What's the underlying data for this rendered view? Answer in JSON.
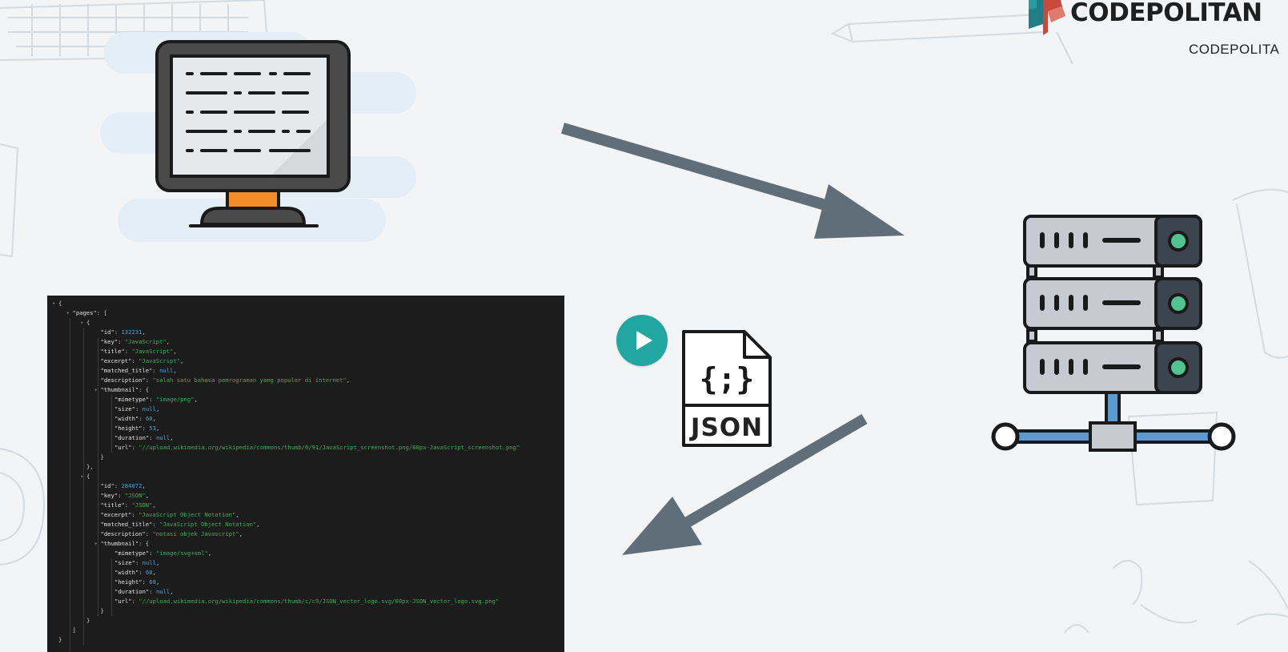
{
  "brand": {
    "name": "CODEPOLITAN",
    "sub": "CODEPOLITA"
  },
  "colors": {
    "background": "#f3f4f5",
    "arrow": "#5f6e78",
    "teal": "#22a6a1",
    "orange": "#f28c28",
    "server_body": "#c7cbd1",
    "server_blue": "#5b9bd5",
    "code_bg": "#1c1c1c",
    "code_string": "#3fae5a",
    "code_number": "#4aa3df"
  },
  "icons": {
    "client": "monitor-icon",
    "server": "server-rack-icon",
    "file": "json-file-icon",
    "play": "play-icon"
  },
  "json_file": {
    "braces": "{;}",
    "label": "JSON"
  },
  "code_lines": [
    {
      "toggle": "▾",
      "indent": 0,
      "text": [
        {
          "t": "punc",
          "v": "{"
        }
      ]
    },
    {
      "toggle": "▾",
      "indent": 1,
      "text": [
        {
          "t": "key",
          "v": "\"pages\""
        },
        {
          "t": "punc",
          "v": ": ["
        }
      ]
    },
    {
      "toggle": "▾",
      "indent": 2,
      "text": [
        {
          "t": "punc",
          "v": "{"
        }
      ]
    },
    {
      "toggle": "",
      "indent": 3,
      "text": [
        {
          "t": "key",
          "v": "\"id\""
        },
        {
          "t": "punc",
          "v": ": "
        },
        {
          "t": "num",
          "v": "132231"
        },
        {
          "t": "punc",
          "v": ","
        }
      ]
    },
    {
      "toggle": "",
      "indent": 3,
      "text": [
        {
          "t": "key",
          "v": "\"key\""
        },
        {
          "t": "punc",
          "v": ": "
        },
        {
          "t": "str",
          "v": "\"JavaScript\""
        },
        {
          "t": "punc",
          "v": ","
        }
      ]
    },
    {
      "toggle": "",
      "indent": 3,
      "text": [
        {
          "t": "key",
          "v": "\"title\""
        },
        {
          "t": "punc",
          "v": ": "
        },
        {
          "t": "str",
          "v": "\"JavaScript\""
        },
        {
          "t": "punc",
          "v": ","
        }
      ]
    },
    {
      "toggle": "",
      "indent": 3,
      "text": [
        {
          "t": "key",
          "v": "\"excerpt\""
        },
        {
          "t": "punc",
          "v": ": "
        },
        {
          "t": "str",
          "v": "\"JavaScript\""
        },
        {
          "t": "punc",
          "v": ","
        }
      ]
    },
    {
      "toggle": "",
      "indent": 3,
      "text": [
        {
          "t": "key",
          "v": "\"matched_title\""
        },
        {
          "t": "punc",
          "v": ": "
        },
        {
          "t": "null",
          "v": "null"
        },
        {
          "t": "punc",
          "v": ","
        }
      ]
    },
    {
      "toggle": "",
      "indent": 3,
      "text": [
        {
          "t": "key",
          "v": "\"description\""
        },
        {
          "t": "punc",
          "v": ": "
        },
        {
          "t": "str",
          "v": "\"salah satu bahasa pemrograman yang populer di internet\""
        },
        {
          "t": "punc",
          "v": ","
        }
      ]
    },
    {
      "toggle": "▾",
      "indent": 3,
      "text": [
        {
          "t": "key",
          "v": "\"thumbnail\""
        },
        {
          "t": "punc",
          "v": ": {"
        }
      ]
    },
    {
      "toggle": "",
      "indent": 4,
      "text": [
        {
          "t": "key",
          "v": "\"mimetype\""
        },
        {
          "t": "punc",
          "v": ": "
        },
        {
          "t": "str",
          "v": "\"image/png\""
        },
        {
          "t": "punc",
          "v": ","
        }
      ]
    },
    {
      "toggle": "",
      "indent": 4,
      "text": [
        {
          "t": "key",
          "v": "\"size\""
        },
        {
          "t": "punc",
          "v": ": "
        },
        {
          "t": "null",
          "v": "null"
        },
        {
          "t": "punc",
          "v": ","
        }
      ]
    },
    {
      "toggle": "",
      "indent": 4,
      "text": [
        {
          "t": "key",
          "v": "\"width\""
        },
        {
          "t": "punc",
          "v": ": "
        },
        {
          "t": "num",
          "v": "60"
        },
        {
          "t": "punc",
          "v": ","
        }
      ]
    },
    {
      "toggle": "",
      "indent": 4,
      "text": [
        {
          "t": "key",
          "v": "\"height\""
        },
        {
          "t": "punc",
          "v": ": "
        },
        {
          "t": "num",
          "v": "53"
        },
        {
          "t": "punc",
          "v": ","
        }
      ]
    },
    {
      "toggle": "",
      "indent": 4,
      "text": [
        {
          "t": "key",
          "v": "\"duration\""
        },
        {
          "t": "punc",
          "v": ": "
        },
        {
          "t": "null",
          "v": "null"
        },
        {
          "t": "punc",
          "v": ","
        }
      ]
    },
    {
      "toggle": "",
      "indent": 4,
      "text": [
        {
          "t": "key",
          "v": "\"url\""
        },
        {
          "t": "punc",
          "v": ": "
        },
        {
          "t": "str",
          "v": "\"//upload.wikimedia.org/wikipedia/commons/thumb/6/91/JavaScript_screenshot.png/60px-JavaScript_screenshot.png\""
        }
      ]
    },
    {
      "toggle": "",
      "indent": 3,
      "text": [
        {
          "t": "punc",
          "v": "}"
        }
      ]
    },
    {
      "toggle": "",
      "indent": 2,
      "text": [
        {
          "t": "punc",
          "v": "},"
        }
      ]
    },
    {
      "toggle": "▾",
      "indent": 2,
      "text": [
        {
          "t": "punc",
          "v": "{"
        }
      ]
    },
    {
      "toggle": "",
      "indent": 3,
      "text": [
        {
          "t": "key",
          "v": "\"id\""
        },
        {
          "t": "punc",
          "v": ": "
        },
        {
          "t": "num",
          "v": "284072"
        },
        {
          "t": "punc",
          "v": ","
        }
      ]
    },
    {
      "toggle": "",
      "indent": 3,
      "text": [
        {
          "t": "key",
          "v": "\"key\""
        },
        {
          "t": "punc",
          "v": ": "
        },
        {
          "t": "str",
          "v": "\"JSON\""
        },
        {
          "t": "punc",
          "v": ","
        }
      ]
    },
    {
      "toggle": "",
      "indent": 3,
      "text": [
        {
          "t": "key",
          "v": "\"title\""
        },
        {
          "t": "punc",
          "v": ": "
        },
        {
          "t": "str",
          "v": "\"JSON\""
        },
        {
          "t": "punc",
          "v": ","
        }
      ]
    },
    {
      "toggle": "",
      "indent": 3,
      "text": [
        {
          "t": "key",
          "v": "\"excerpt\""
        },
        {
          "t": "punc",
          "v": ": "
        },
        {
          "t": "str",
          "v": "\"JavaScript Object Notation\""
        },
        {
          "t": "punc",
          "v": ","
        }
      ]
    },
    {
      "toggle": "",
      "indent": 3,
      "text": [
        {
          "t": "key",
          "v": "\"matched_title\""
        },
        {
          "t": "punc",
          "v": ": "
        },
        {
          "t": "str",
          "v": "\"JavaScript Object Notation\""
        },
        {
          "t": "punc",
          "v": ","
        }
      ]
    },
    {
      "toggle": "",
      "indent": 3,
      "text": [
        {
          "t": "key",
          "v": "\"description\""
        },
        {
          "t": "punc",
          "v": ": "
        },
        {
          "t": "str",
          "v": "\"notasi objek Javascript\""
        },
        {
          "t": "punc",
          "v": ","
        }
      ]
    },
    {
      "toggle": "▾",
      "indent": 3,
      "text": [
        {
          "t": "key",
          "v": "\"thumbnail\""
        },
        {
          "t": "punc",
          "v": ": {"
        }
      ]
    },
    {
      "toggle": "",
      "indent": 4,
      "text": [
        {
          "t": "key",
          "v": "\"mimetype\""
        },
        {
          "t": "punc",
          "v": ": "
        },
        {
          "t": "str",
          "v": "\"image/svg+xml\""
        },
        {
          "t": "punc",
          "v": ","
        }
      ]
    },
    {
      "toggle": "",
      "indent": 4,
      "text": [
        {
          "t": "key",
          "v": "\"size\""
        },
        {
          "t": "punc",
          "v": ": "
        },
        {
          "t": "null",
          "v": "null"
        },
        {
          "t": "punc",
          "v": ","
        }
      ]
    },
    {
      "toggle": "",
      "indent": 4,
      "text": [
        {
          "t": "key",
          "v": "\"width\""
        },
        {
          "t": "punc",
          "v": ": "
        },
        {
          "t": "num",
          "v": "60"
        },
        {
          "t": "punc",
          "v": ","
        }
      ]
    },
    {
      "toggle": "",
      "indent": 4,
      "text": [
        {
          "t": "key",
          "v": "\"height\""
        },
        {
          "t": "punc",
          "v": ": "
        },
        {
          "t": "num",
          "v": "60"
        },
        {
          "t": "punc",
          "v": ","
        }
      ]
    },
    {
      "toggle": "",
      "indent": 4,
      "text": [
        {
          "t": "key",
          "v": "\"duration\""
        },
        {
          "t": "punc",
          "v": ": "
        },
        {
          "t": "null",
          "v": "null"
        },
        {
          "t": "punc",
          "v": ","
        }
      ]
    },
    {
      "toggle": "",
      "indent": 4,
      "text": [
        {
          "t": "key",
          "v": "\"url\""
        },
        {
          "t": "punc",
          "v": ": "
        },
        {
          "t": "str",
          "v": "\"//upload.wikimedia.org/wikipedia/commons/thumb/c/c9/JSON_vector_logo.svg/60px-JSON_vector_logo.svg.png\""
        }
      ]
    },
    {
      "toggle": "",
      "indent": 3,
      "text": [
        {
          "t": "punc",
          "v": "}"
        }
      ]
    },
    {
      "toggle": "",
      "indent": 2,
      "text": [
        {
          "t": "punc",
          "v": "}"
        }
      ]
    },
    {
      "toggle": "",
      "indent": 1,
      "text": [
        {
          "t": "punc",
          "v": "]"
        }
      ]
    },
    {
      "toggle": "",
      "indent": 0,
      "text": [
        {
          "t": "punc",
          "v": "}"
        }
      ]
    }
  ]
}
